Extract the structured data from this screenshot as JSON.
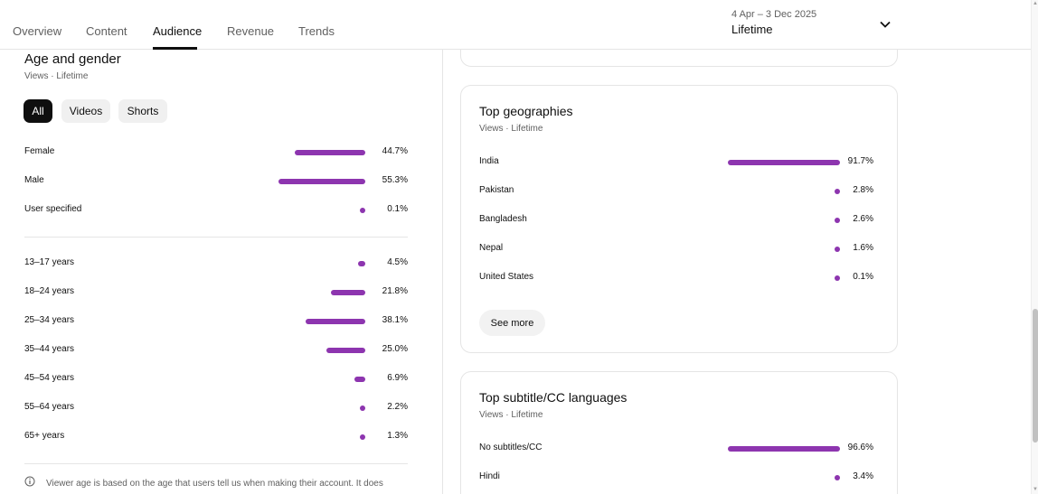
{
  "nav": {
    "tabs": [
      "Overview",
      "Content",
      "Audience",
      "Revenue",
      "Trends"
    ],
    "active_tab": "Audience",
    "date_range": "4 Apr – 3 Dec 2025",
    "period": "Lifetime"
  },
  "age_gender": {
    "title": "Age and gender",
    "subtitle": "Views · Lifetime",
    "chips": [
      "All",
      "Videos",
      "Shorts"
    ],
    "active_chip": "All",
    "gender": [
      {
        "label": "Female",
        "value": "44.7%",
        "pct": 44.7
      },
      {
        "label": "Male",
        "value": "55.3%",
        "pct": 55.3
      },
      {
        "label": "User specified",
        "value": "0.1%",
        "pct": 0.1
      }
    ],
    "ages": [
      {
        "label": "13–17 years",
        "value": "4.5%",
        "pct": 4.5
      },
      {
        "label": "18–24 years",
        "value": "21.8%",
        "pct": 21.8
      },
      {
        "label": "25–34 years",
        "value": "38.1%",
        "pct": 38.1
      },
      {
        "label": "35–44 years",
        "value": "25.0%",
        "pct": 25.0
      },
      {
        "label": "45–54 years",
        "value": "6.9%",
        "pct": 6.9
      },
      {
        "label": "55–64 years",
        "value": "2.2%",
        "pct": 2.2
      },
      {
        "label": "65+ years",
        "value": "1.3%",
        "pct": 1.3
      }
    ],
    "note": "Viewer age is based on the age that users tell us when making their account. It does"
  },
  "geographies": {
    "title": "Top geographies",
    "subtitle": "Views · Lifetime",
    "rows": [
      {
        "label": "India",
        "value": "91.7%",
        "pct": 91.7
      },
      {
        "label": "Pakistan",
        "value": "2.8%",
        "pct": 2.8
      },
      {
        "label": "Bangladesh",
        "value": "2.6%",
        "pct": 2.6
      },
      {
        "label": "Nepal",
        "value": "1.6%",
        "pct": 1.6
      },
      {
        "label": "United States",
        "value": "0.1%",
        "pct": 0.1
      }
    ],
    "see_more": "See more"
  },
  "subtitles": {
    "title": "Top subtitle/CC languages",
    "subtitle": "Views · Lifetime",
    "rows": [
      {
        "label": "No subtitles/CC",
        "value": "96.6%",
        "pct": 96.6
      },
      {
        "label": "Hindi",
        "value": "3.4%",
        "pct": 3.4
      }
    ]
  },
  "colors": {
    "bar": "#8d35af",
    "active_chip": "#0f0f0f"
  }
}
